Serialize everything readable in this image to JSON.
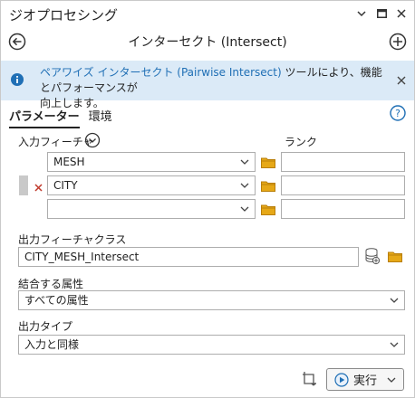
{
  "window": {
    "title": "ジオプロセシング"
  },
  "nav": {
    "tool_title": "インターセクト (Intersect)"
  },
  "banner": {
    "link_text": "ペアワイズ インターセクト (Pairwise Intersect)",
    "text_suffix": " ツールにより、機能とパフォーマンスが",
    "text_line2": "向上します。"
  },
  "tabs": [
    {
      "label": "パラメーター",
      "active": true
    },
    {
      "label": "環境",
      "active": false
    }
  ],
  "input_features": {
    "label": "入力フィーチャ",
    "rank_label": "ランク",
    "rows": [
      {
        "value": "MESH",
        "rank": ""
      },
      {
        "value": "CITY",
        "rank": ""
      },
      {
        "value": "",
        "rank": ""
      }
    ]
  },
  "output_feature_class": {
    "label": "出力フィーチャクラス",
    "value": "CITY_MESH_Intersect"
  },
  "join_attributes": {
    "label": "結合する属性",
    "value": "すべての属性"
  },
  "output_type": {
    "label": "出力タイプ",
    "value": "入力と同様"
  },
  "run": {
    "label": "実行"
  },
  "colors": {
    "info_blue": "#1f6fb5",
    "banner_bg": "#dbeaf7",
    "folder_yellow": "#e6a817",
    "remove_red": "#c0392b"
  }
}
